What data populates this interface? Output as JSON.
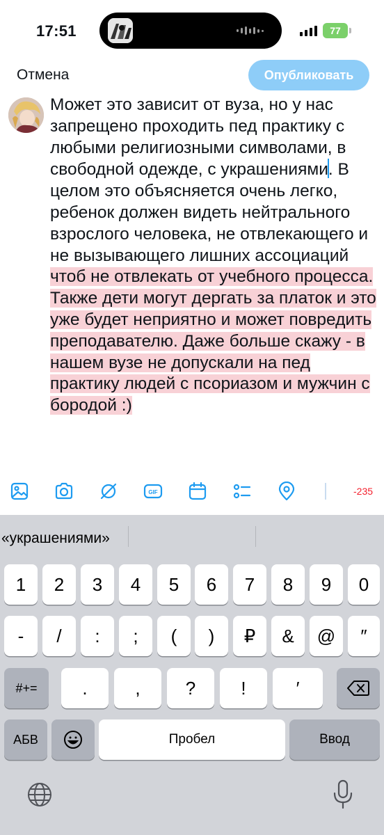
{
  "status_bar": {
    "time": "17:51",
    "battery": "77"
  },
  "compose": {
    "cancel_label": "Отмена",
    "publish_label": "Опубликовать",
    "text_before_caret": "Может это зависит от вуза, но у нас запрещено проходить пед практику с любыми религиозными символами, в свободной одежде, с украшениями",
    "text_after_caret": ". В целом это объясняется очень легко, ребенок должен видеть нейтрального взрослого человека, не отвлекающего и не вызывающего лишних ассоциаций ",
    "text_over_limit": "чтоб не отвлекать от учебного процесса. Также дети могут дергать за платок и это уже будет неприятно и может повредить преподавателю. Даже больше скажу - в нашем вузе не допускали на пед практику людей с псориазом и мужчин с бородой :)",
    "char_counter": "-235"
  },
  "toolbar": {
    "icons": [
      "image-icon",
      "camera-icon",
      "grok-icon",
      "gif-icon",
      "schedule-icon",
      "poll-icon",
      "location-icon",
      "char-ring-icon"
    ]
  },
  "keyboard": {
    "suggestion": "«украшениями»",
    "row1": [
      "1",
      "2",
      "3",
      "4",
      "5",
      "6",
      "7",
      "8",
      "9",
      "0"
    ],
    "row2": [
      "-",
      "/",
      ":",
      ";",
      "(",
      ")",
      "₽",
      "&",
      "@",
      "″"
    ],
    "row3": [
      ".",
      ",",
      "?",
      "!",
      "′"
    ],
    "symbols_label": "#+=",
    "lang_label": "АБВ",
    "space_label": "Пробел",
    "return_label": "Ввод"
  },
  "colors": {
    "accent": "#1d9bf0",
    "publish_disabled": "#8ecdf8",
    "over_limit": "#f8d1d6",
    "counter": "#f4212e",
    "keyboard_bg": "#d2d4d9"
  }
}
